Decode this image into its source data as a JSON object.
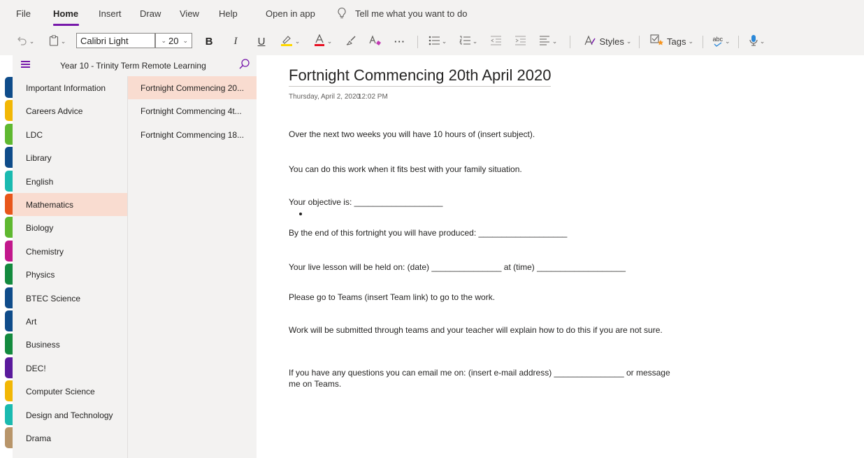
{
  "menu": {
    "file": "File",
    "home": "Home",
    "insert": "Insert",
    "draw": "Draw",
    "view": "View",
    "help": "Help",
    "open_in_app": "Open in app",
    "tell_me": "Tell me what you want to do"
  },
  "toolbar": {
    "font_name": "Calibri Light",
    "font_size": "20",
    "bold": "B",
    "italic": "I",
    "underline": "U",
    "more": "···",
    "styles": "Styles",
    "tags": "Tags",
    "spell": "abc",
    "highlight_color": "#ffd800",
    "font_color": "#e81123"
  },
  "notebook": {
    "title": "Year 10 - Trinity Term Remote Learning"
  },
  "sections": [
    {
      "label": "Important Information",
      "color": "#0f4c8a"
    },
    {
      "label": "Careers Advice",
      "color": "#f2b705"
    },
    {
      "label": "LDC",
      "color": "#5fb830"
    },
    {
      "label": "Library",
      "color": "#0f4c8a"
    },
    {
      "label": "English",
      "color": "#1abab0"
    },
    {
      "label": "Mathematics",
      "color": "#e8561a"
    },
    {
      "label": "Biology",
      "color": "#5fb830"
    },
    {
      "label": "Chemistry",
      "color": "#c2188c"
    },
    {
      "label": "Physics",
      "color": "#138a3e"
    },
    {
      "label": "BTEC Science",
      "color": "#0f4c8a"
    },
    {
      "label": "Art",
      "color": "#0f4c8a"
    },
    {
      "label": "Business",
      "color": "#138a3e"
    },
    {
      "label": "DEC!",
      "color": "#5a1a9c"
    },
    {
      "label": "Computer Science",
      "color": "#f2b705"
    },
    {
      "label": "Design and Technology",
      "color": "#1abab0"
    },
    {
      "label": "Drama",
      "color": "#b8956a"
    }
  ],
  "pages": [
    {
      "label": "Fortnight Commencing 20..."
    },
    {
      "label": "Fortnight Commencing 4t..."
    },
    {
      "label": "Fortnight Commencing 18..."
    }
  ],
  "page": {
    "title": "Fortnight Commencing 20th April 2020",
    "date": "Thursday, April 2, 2020",
    "time": "12:02 PM",
    "paragraphs": [
      "Over the next two weeks you will have 10 hours of (insert subject).",
      "You can do this work when it fits best with your family situation.",
      "Your objective is: ___________________",
      "By the end of this fortnight you will have produced: ___________________",
      "Your live lesson will be held on: (date) _______________ at (time) ___________________",
      "Please go to Teams (insert Team link) to go to the work.",
      "Work will be submitted through teams and your teacher will explain how to do this if you are not sure.",
      "If you have any questions you can email me on: (insert e-mail address) _______________  or message me on Teams."
    ]
  }
}
